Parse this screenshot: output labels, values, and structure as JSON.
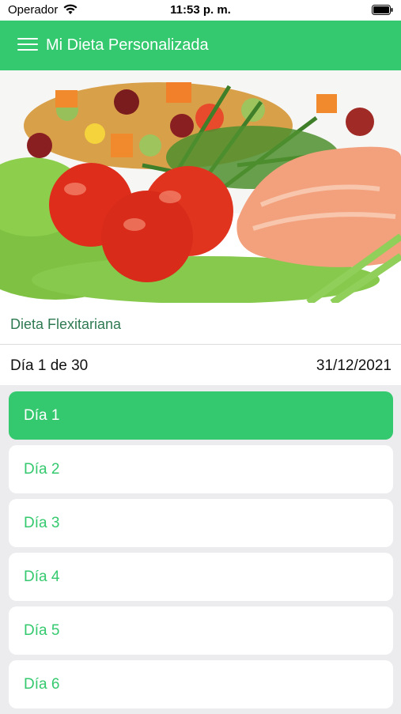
{
  "status_bar": {
    "carrier": "Operador",
    "time": "11:53 p. m."
  },
  "header": {
    "title": "Mi Dieta Personalizada"
  },
  "hero": {
    "icon": "food-plate-image"
  },
  "diet": {
    "name": "Dieta Flexitariana"
  },
  "progress": {
    "day_label": "Día 1 de 30",
    "date": "31/12/2021"
  },
  "days": [
    {
      "label": "Día 1",
      "selected": true
    },
    {
      "label": "Día 2",
      "selected": false
    },
    {
      "label": "Día 3",
      "selected": false
    },
    {
      "label": "Día 4",
      "selected": false
    },
    {
      "label": "Día 5",
      "selected": false
    },
    {
      "label": "Día 6",
      "selected": false
    }
  ],
  "colors": {
    "accent": "#34c96e",
    "background": "#ececee",
    "diet_name": "#2f7a52"
  }
}
